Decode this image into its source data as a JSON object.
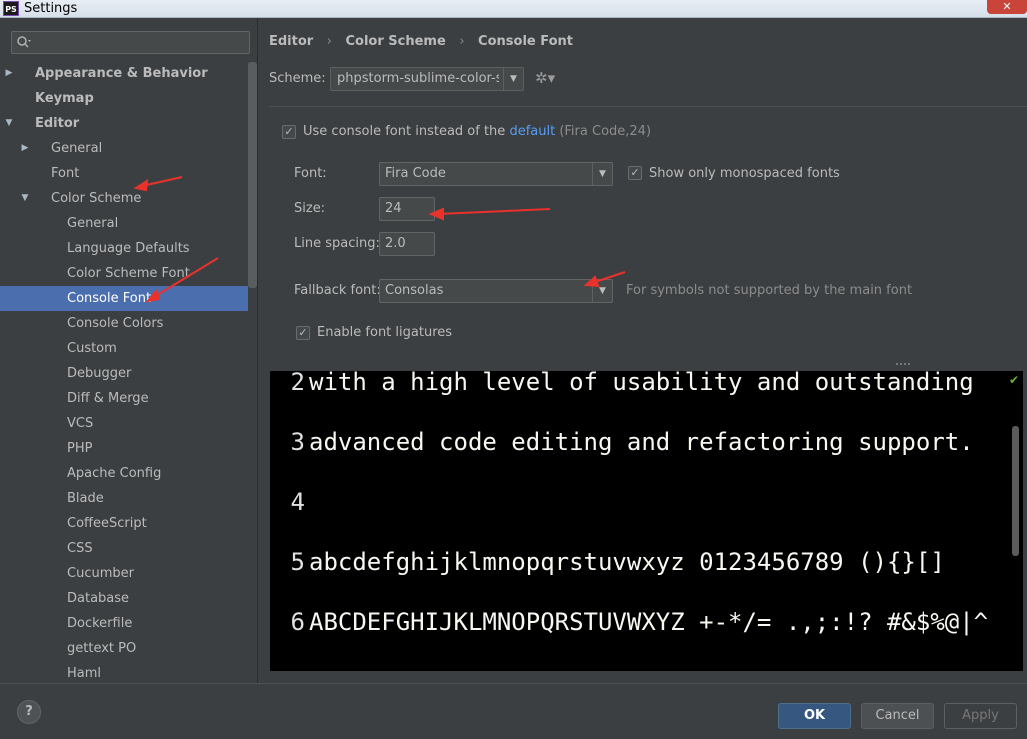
{
  "window": {
    "app_icon_text": "PS",
    "title": "Settings"
  },
  "sidebar": {
    "search": {
      "placeholder": ""
    },
    "items": [
      {
        "label": "Appearance & Behavior",
        "arrow": "▶"
      },
      {
        "label": "Keymap",
        "arrow": ""
      },
      {
        "label": "Editor",
        "arrow": "▼"
      },
      {
        "label": "General",
        "arrow": "▶"
      },
      {
        "label": "Font",
        "arrow": ""
      },
      {
        "label": "Color Scheme",
        "arrow": "▼"
      },
      {
        "label": "General",
        "arrow": ""
      },
      {
        "label": "Language Defaults",
        "arrow": ""
      },
      {
        "label": "Color Scheme Font",
        "arrow": ""
      },
      {
        "label": "Console Font",
        "arrow": ""
      },
      {
        "label": "Console Colors",
        "arrow": ""
      },
      {
        "label": "Custom",
        "arrow": ""
      },
      {
        "label": "Debugger",
        "arrow": ""
      },
      {
        "label": "Diff & Merge",
        "arrow": ""
      },
      {
        "label": "VCS",
        "arrow": ""
      },
      {
        "label": "PHP",
        "arrow": ""
      },
      {
        "label": "Apache Config",
        "arrow": ""
      },
      {
        "label": "Blade",
        "arrow": ""
      },
      {
        "label": "CoffeeScript",
        "arrow": ""
      },
      {
        "label": "CSS",
        "arrow": ""
      },
      {
        "label": "Cucumber",
        "arrow": ""
      },
      {
        "label": "Database",
        "arrow": ""
      },
      {
        "label": "Dockerfile",
        "arrow": ""
      },
      {
        "label": "gettext PO",
        "arrow": ""
      },
      {
        "label": "Haml",
        "arrow": ""
      }
    ]
  },
  "breadcrumb": {
    "items": [
      "Editor",
      "Color Scheme",
      "Console Font"
    ],
    "separator": "›"
  },
  "scheme": {
    "label": "Scheme:",
    "value": "phpstorm-sublime-color-sys",
    "arrow": "▼",
    "gear_glyph": "✲▾"
  },
  "use_console_font": {
    "checked": true,
    "check_glyph": "✓",
    "text": "Use console font instead of the",
    "link": "default",
    "hint": "(Fira Code,24)"
  },
  "font": {
    "label": "Font:",
    "value": "Fira Code",
    "arrow": "▼"
  },
  "monospaced": {
    "checked": true,
    "label": "Show only monospaced fonts"
  },
  "size": {
    "label": "Size:",
    "value": "24"
  },
  "line_spacing": {
    "label": "Line spacing:",
    "value": "2.0"
  },
  "fallback": {
    "label": "Fallback font:",
    "value": "Consolas",
    "arrow": "▼",
    "hint": "For symbols not supported by the main font"
  },
  "ligatures": {
    "checked": true,
    "label": "Enable font ligatures"
  },
  "preview": {
    "ok_glyph": "✔",
    "lines": [
      {
        "num": "2",
        "text": "with a high level of usability and outstanding"
      },
      {
        "num": "3",
        "text": "advanced code editing and refactoring support."
      },
      {
        "num": "4",
        "text": ""
      },
      {
        "num": "5",
        "text": "abcdefghijklmnopqrstuvwxyz 0123456789 (){}[]"
      },
      {
        "num": "6",
        "text": "ABCDEFGHIJKLMNOPQRSTUVWXYZ +-*/= .,;:!? #&$%@|^"
      }
    ]
  },
  "buttons": {
    "help": "?",
    "ok": "OK",
    "cancel": "Cancel",
    "apply": "Apply"
  },
  "colors": {
    "accent": "#4b6eaf",
    "annotation": "#e8322b"
  }
}
